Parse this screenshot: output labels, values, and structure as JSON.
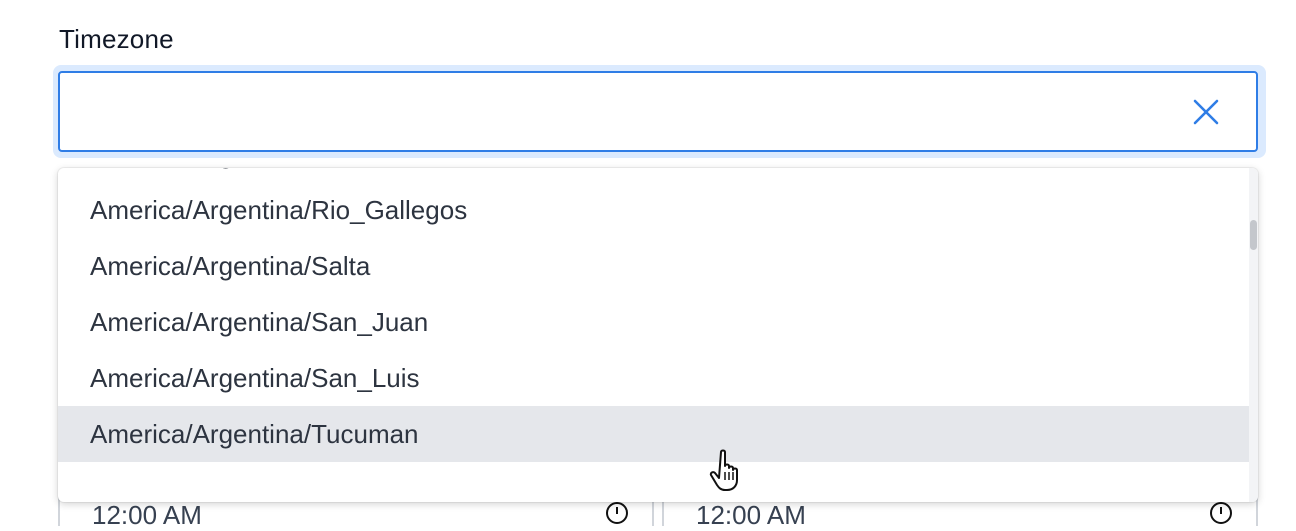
{
  "field": {
    "label": "Timezone",
    "value": "",
    "placeholder": "",
    "clear_icon": "close-icon"
  },
  "dropdown": {
    "options": [
      "America/Argentina/Mendoza",
      "America/Argentina/Rio_Gallegos",
      "America/Argentina/Salta",
      "America/Argentina/San_Juan",
      "America/Argentina/San_Luis",
      "America/Argentina/Tucuman"
    ],
    "hovered_index": 5
  },
  "background": {
    "start_time": "12:00 AM",
    "end_time": "12:00 AM"
  },
  "colors": {
    "accent": "#2f7de6",
    "focus_ring": "#dbeafe",
    "hover_row": "#e5e7eb"
  }
}
